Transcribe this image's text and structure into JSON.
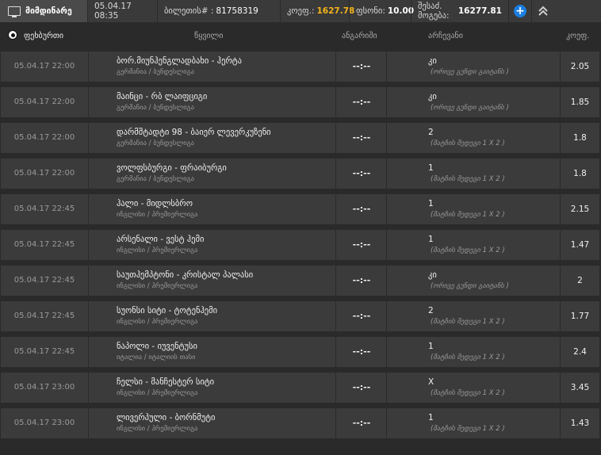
{
  "topbar": {
    "current_tab": "მიმდინარე",
    "datetime": "05.04.17 08:35",
    "ticket_label": "ბილეთის# :",
    "ticket_number": "81758319",
    "coef_label": "კოეფ.:",
    "coef_value": "1627.78",
    "stake_label": "ფსონი:",
    "stake_value": "10.00",
    "possible_label": "შესაძ. მოგება:",
    "possible_value": "16277.81"
  },
  "header": {
    "sport": "ფეხბურთი",
    "event": "წყვილი",
    "score": "ანგარიში",
    "choice": "არჩევანი",
    "coef": "კოეფ."
  },
  "rows": [
    {
      "date": "05.04.17 22:00",
      "match": "ბორ.მიუნჰენგლადბახი - ჰერტა",
      "league": "გერმანია / ბუნდესლიგა",
      "score": "--:--",
      "pick": "კი",
      "pick_desc": "(ორივე გუნდი გაიტანს )",
      "coef": "2.05"
    },
    {
      "date": "05.04.17 22:00",
      "match": "მაინცი - რბ ლაიფციგი",
      "league": "გერმანია / ბუნდესლიგა",
      "score": "--:--",
      "pick": "კი",
      "pick_desc": "(ორივე გუნდი გაიტანს )",
      "coef": "1.85"
    },
    {
      "date": "05.04.17 22:00",
      "match": "დარმშტადტი 98 - ბაიერ ლევერკუზენი",
      "league": "გერმანია / ბუნდესლიგა",
      "score": "--:--",
      "pick": "2",
      "pick_desc": "(მატჩის შედეგი 1 X 2 )",
      "coef": "1.8"
    },
    {
      "date": "05.04.17 22:00",
      "match": "ვოლფსბურგი - ფრაიბურგი",
      "league": "გერმანია / ბუნდესლიგა",
      "score": "--:--",
      "pick": "1",
      "pick_desc": "(მატჩის შედეგი 1 X 2 )",
      "coef": "1.8"
    },
    {
      "date": "05.04.17 22:45",
      "match": "ჰალი - მიდლსბრო",
      "league": "ინგლისი / პრემიერლიგა",
      "score": "--:--",
      "pick": "1",
      "pick_desc": "(მატჩის შედეგი 1 X 2 )",
      "coef": "2.15"
    },
    {
      "date": "05.04.17 22:45",
      "match": "არსენალი - ვესტ ჰემი",
      "league": "ინგლისი / პრემიერლიგა",
      "score": "--:--",
      "pick": "1",
      "pick_desc": "(მატჩის შედეგი 1 X 2 )",
      "coef": "1.47"
    },
    {
      "date": "05.04.17 22:45",
      "match": "საუთჰემპტონი - კრისტალ პალასი",
      "league": "ინგლისი / პრემიერლიგა",
      "score": "--:--",
      "pick": "კი",
      "pick_desc": "(ორივე გუნდი გაიტანს )",
      "coef": "2"
    },
    {
      "date": "05.04.17 22:45",
      "match": "სუონსი სიტი - ტოტენჰემი",
      "league": "ინგლისი / პრემიერლიგა",
      "score": "--:--",
      "pick": "2",
      "pick_desc": "(მატჩის შედეგი 1 X 2 )",
      "coef": "1.77"
    },
    {
      "date": "05.04.17 22:45",
      "match": "ნაპოლი - იუვენტუსი",
      "league": "იტალია / იტალიის თასი",
      "score": "--:--",
      "pick": "1",
      "pick_desc": "(მატჩის შედეგი 1 X 2 )",
      "coef": "2.4"
    },
    {
      "date": "05.04.17 23:00",
      "match": "ჩელსი - მანჩესტერ სიტი",
      "league": "ინგლისი / პრემიერლიგა",
      "score": "--:--",
      "pick": "X",
      "pick_desc": "(მატჩის შედეგი 1 X 2 )",
      "coef": "3.45"
    },
    {
      "date": "05.04.17 23:00",
      "match": "ლივერპული - ბორნმუტი",
      "league": "ინგლისი / პრემიერლიგა",
      "score": "--:--",
      "pick": "1",
      "pick_desc": "(მატჩის შედეგი 1 X 2 )",
      "coef": "1.43"
    }
  ]
}
